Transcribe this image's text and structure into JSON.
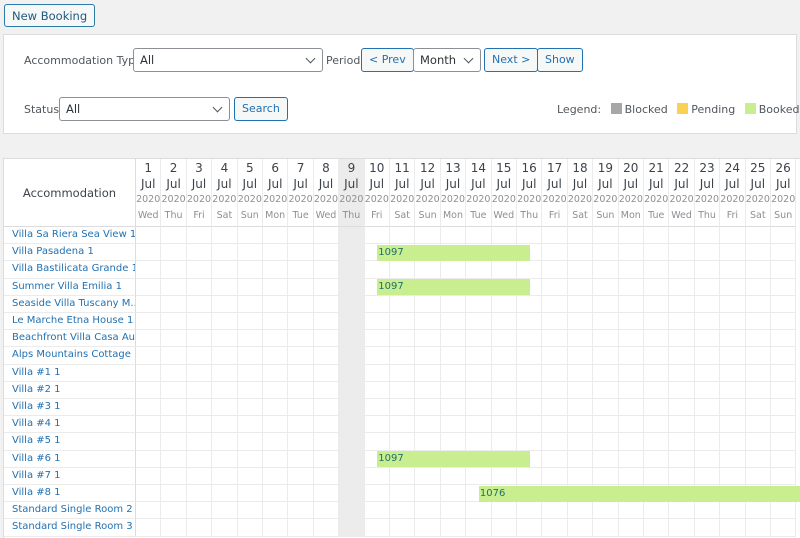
{
  "toolbar": {
    "new_booking_label": "New Booking"
  },
  "filters": {
    "accommodation_type_label": "Accommodation Type:",
    "accommodation_type_value": "All",
    "period_label": "Period:",
    "prev_label": "< Prev",
    "period_value": "Month",
    "next_label": "Next >",
    "show_label": "Show",
    "status_label": "Status:",
    "status_value": "All",
    "search_label": "Search"
  },
  "legend": {
    "label": "Legend:",
    "items": [
      {
        "label": "Blocked",
        "color": "#a7a7a7"
      },
      {
        "label": "Pending",
        "color": "#fbd154"
      },
      {
        "label": "Booked",
        "color": "#c9ee8f"
      }
    ]
  },
  "calendar": {
    "accommodation_header": "Accommodation",
    "today_day": 9,
    "days": [
      {
        "d": "1",
        "m": "Jul",
        "y": "2020",
        "w": "Wed"
      },
      {
        "d": "2",
        "m": "Jul",
        "y": "2020",
        "w": "Thu"
      },
      {
        "d": "3",
        "m": "Jul",
        "y": "2020",
        "w": "Fri"
      },
      {
        "d": "4",
        "m": "Jul",
        "y": "2020",
        "w": "Sat"
      },
      {
        "d": "5",
        "m": "Jul",
        "y": "2020",
        "w": "Sun"
      },
      {
        "d": "6",
        "m": "Jul",
        "y": "2020",
        "w": "Mon"
      },
      {
        "d": "7",
        "m": "Jul",
        "y": "2020",
        "w": "Tue"
      },
      {
        "d": "8",
        "m": "Jul",
        "y": "2020",
        "w": "Wed"
      },
      {
        "d": "9",
        "m": "Jul",
        "y": "2020",
        "w": "Thu"
      },
      {
        "d": "10",
        "m": "Jul",
        "y": "2020",
        "w": "Fri"
      },
      {
        "d": "11",
        "m": "Jul",
        "y": "2020",
        "w": "Sat"
      },
      {
        "d": "12",
        "m": "Jul",
        "y": "2020",
        "w": "Sun"
      },
      {
        "d": "13",
        "m": "Jul",
        "y": "2020",
        "w": "Mon"
      },
      {
        "d": "14",
        "m": "Jul",
        "y": "2020",
        "w": "Tue"
      },
      {
        "d": "15",
        "m": "Jul",
        "y": "2020",
        "w": "Wed"
      },
      {
        "d": "16",
        "m": "Jul",
        "y": "2020",
        "w": "Thu"
      },
      {
        "d": "17",
        "m": "Jul",
        "y": "2020",
        "w": "Fri"
      },
      {
        "d": "18",
        "m": "Jul",
        "y": "2020",
        "w": "Sat"
      },
      {
        "d": "19",
        "m": "Jul",
        "y": "2020",
        "w": "Sun"
      },
      {
        "d": "20",
        "m": "Jul",
        "y": "2020",
        "w": "Mon"
      },
      {
        "d": "21",
        "m": "Jul",
        "y": "2020",
        "w": "Tue"
      },
      {
        "d": "22",
        "m": "Jul",
        "y": "2020",
        "w": "Wed"
      },
      {
        "d": "23",
        "m": "Jul",
        "y": "2020",
        "w": "Thu"
      },
      {
        "d": "24",
        "m": "Jul",
        "y": "2020",
        "w": "Fri"
      },
      {
        "d": "25",
        "m": "Jul",
        "y": "2020",
        "w": "Sat"
      },
      {
        "d": "26",
        "m": "Jul",
        "y": "2020",
        "w": "Sun"
      }
    ],
    "rows": [
      {
        "name": "Villa Sa Riera Sea View 1",
        "bookings": []
      },
      {
        "name": "Villa Pasadena 1",
        "bookings": [
          {
            "id": "1097",
            "check_in_day": 10,
            "check_out_day": 16,
            "status": "booked"
          }
        ]
      },
      {
        "name": "Villa Bastilicata Grande 1",
        "bookings": []
      },
      {
        "name": "Summer Villa Emilia 1",
        "bookings": [
          {
            "id": "1097",
            "check_in_day": 10,
            "check_out_day": 16,
            "status": "booked"
          }
        ]
      },
      {
        "name": "Seaside Villa Tuscany M...",
        "bookings": []
      },
      {
        "name": "Le Marche Etna House 1",
        "bookings": []
      },
      {
        "name": "Beachfront Villa Casa Au...",
        "bookings": []
      },
      {
        "name": "Alps Mountains Cottage ...",
        "bookings": []
      },
      {
        "name": "Villa #1 1",
        "bookings": []
      },
      {
        "name": "Villa #2 1",
        "bookings": []
      },
      {
        "name": "Villa #3 1",
        "bookings": []
      },
      {
        "name": "Villa #4 1",
        "bookings": []
      },
      {
        "name": "Villa #5 1",
        "bookings": []
      },
      {
        "name": "Villa #6 1",
        "bookings": [
          {
            "id": "1097",
            "check_in_day": 10,
            "check_out_day": 16,
            "status": "booked"
          }
        ]
      },
      {
        "name": "Villa #7 1",
        "bookings": []
      },
      {
        "name": "Villa #8 1",
        "bookings": [
          {
            "id": "1076",
            "check_in_day": 14,
            "check_out_day": null,
            "status": "booked"
          }
        ]
      },
      {
        "name": "Standard Single Room 2",
        "bookings": []
      },
      {
        "name": "Standard Single Room 3",
        "bookings": []
      }
    ]
  }
}
